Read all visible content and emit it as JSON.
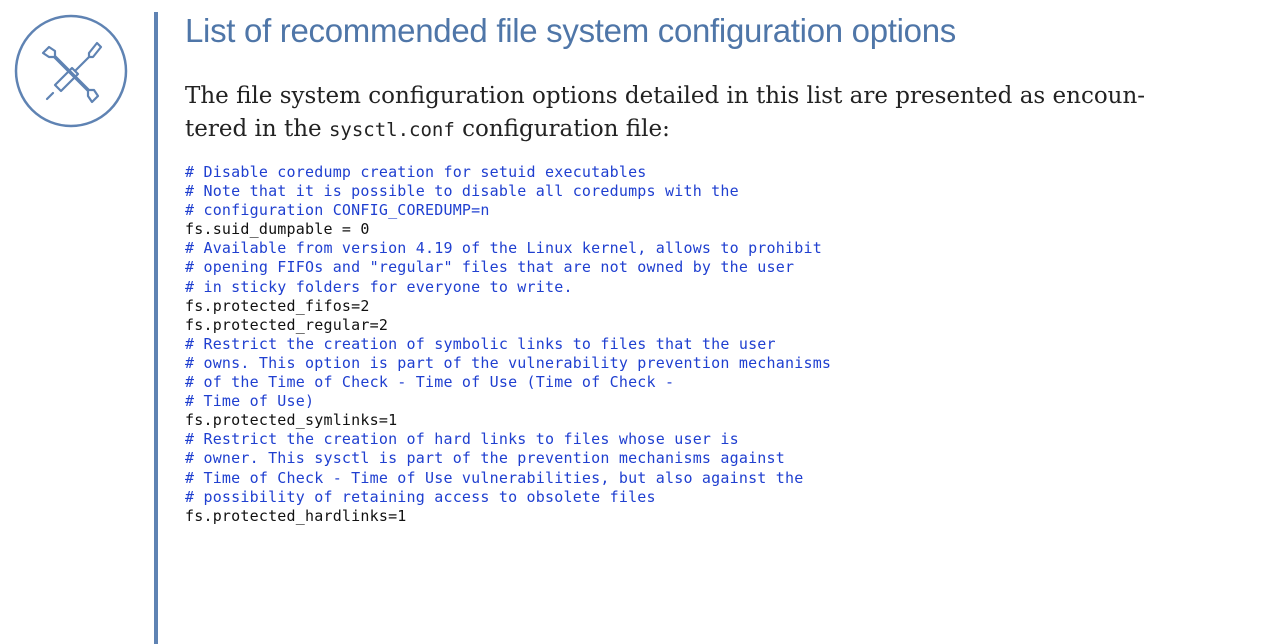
{
  "header": {
    "title": "List of recommended file system configuration options",
    "icon": "tools-icon",
    "accent_color": "#5f83b3"
  },
  "intro": {
    "text_before": "The file system configuration options detailed in this list are presented as encoun-",
    "text_line2_before": "tered in the ",
    "filename": "sysctl.conf",
    "text_after": " configuration file:"
  },
  "code": {
    "comment_color": "#1f3fd0",
    "lines": [
      {
        "kind": "comment",
        "text": "# Disable coredump creation for setuid executables"
      },
      {
        "kind": "comment",
        "text": "# Note that it is possible to disable all coredumps with the"
      },
      {
        "kind": "comment",
        "text": "# configuration CONFIG_COREDUMP=n"
      },
      {
        "kind": "stmt",
        "text": "fs.suid_dumpable = 0"
      },
      {
        "kind": "comment",
        "text": "# Available from version 4.19 of the Linux kernel, allows to prohibit"
      },
      {
        "kind": "comment",
        "text": "# opening FIFOs and \"regular\" files that are not owned by the user"
      },
      {
        "kind": "comment",
        "text": "# in sticky folders for everyone to write."
      },
      {
        "kind": "stmt",
        "text": "fs.protected_fifos=2"
      },
      {
        "kind": "stmt",
        "text": "fs.protected_regular=2"
      },
      {
        "kind": "comment",
        "text": "# Restrict the creation of symbolic links to files that the user"
      },
      {
        "kind": "comment",
        "text": "# owns. This option is part of the vulnerability prevention mechanisms"
      },
      {
        "kind": "comment",
        "text": "# of the Time of Check - Time of Use (Time of Check -"
      },
      {
        "kind": "comment",
        "text": "# Time of Use)"
      },
      {
        "kind": "stmt",
        "text": "fs.protected_symlinks=1"
      },
      {
        "kind": "comment",
        "text": "# Restrict the creation of hard links to files whose user is"
      },
      {
        "kind": "comment",
        "text": "# owner. This sysctl is part of the prevention mechanisms against"
      },
      {
        "kind": "comment",
        "text": "# Time of Check - Time of Use vulnerabilities, but also against the"
      },
      {
        "kind": "comment",
        "text": "# possibility of retaining access to obsolete files"
      },
      {
        "kind": "stmt",
        "text": "fs.protected_hardlinks=1"
      }
    ]
  }
}
